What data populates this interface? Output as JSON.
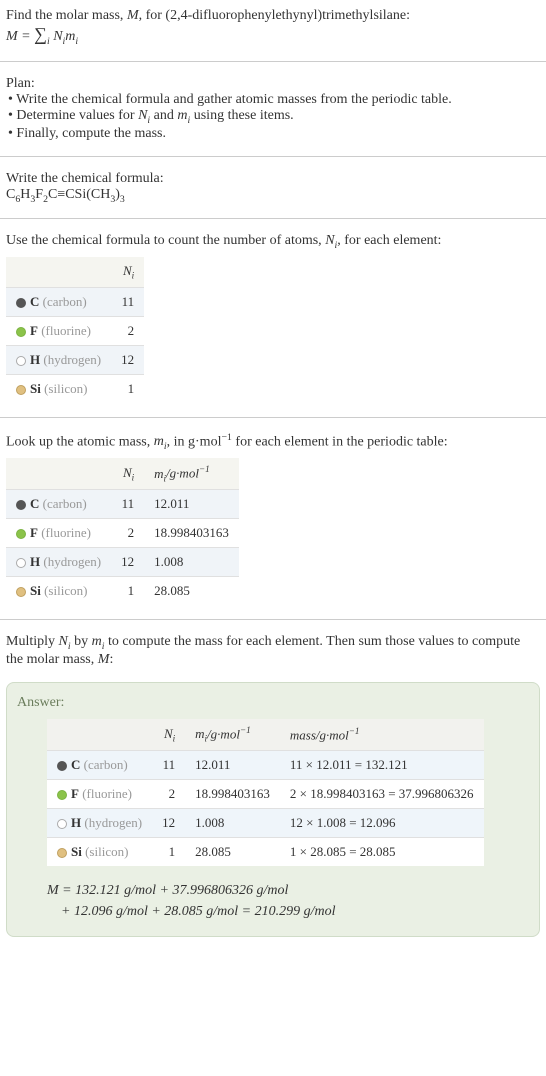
{
  "intro": {
    "line1_prefix": "Find the molar mass, ",
    "line1_var": "M",
    "line1_suffix": ", for (2,4-difluorophenylethynyl)trimethylsilane:",
    "eq_lhs": "M",
    "eq_rhs_html": "∑",
    "eq_sub": "i",
    "eq_tail": " N_i m_i"
  },
  "plan": {
    "title": "Plan:",
    "items": [
      "• Write the chemical formula and gather atomic masses from the periodic table.",
      "• Determine values for N_i and m_i using these items.",
      "• Finally, compute the mass."
    ]
  },
  "formula_section": {
    "heading": "Write the chemical formula:",
    "formula": "C6H3F2C≡CSi(CH3)3"
  },
  "count_section": {
    "heading_prefix": "Use the chemical formula to count the number of atoms, ",
    "heading_var": "N_i",
    "heading_suffix": ", for each element:",
    "header_ni": "N_i",
    "rows": [
      {
        "dot": "dot-c",
        "sym": "C",
        "name": "(carbon)",
        "ni": "11"
      },
      {
        "dot": "dot-f",
        "sym": "F",
        "name": "(fluorine)",
        "ni": "2"
      },
      {
        "dot": "dot-h",
        "sym": "H",
        "name": "(hydrogen)",
        "ni": "12"
      },
      {
        "dot": "dot-si",
        "sym": "Si",
        "name": "(silicon)",
        "ni": "1"
      }
    ]
  },
  "mass_section": {
    "heading": "Look up the atomic mass, m_i, in g·mol⁻¹ for each element in the periodic table:",
    "header_ni": "N_i",
    "header_mi": "m_i/g·mol⁻¹",
    "rows": [
      {
        "dot": "dot-c",
        "sym": "C",
        "name": "(carbon)",
        "ni": "11",
        "mi": "12.011"
      },
      {
        "dot": "dot-f",
        "sym": "F",
        "name": "(fluorine)",
        "ni": "2",
        "mi": "18.998403163"
      },
      {
        "dot": "dot-h",
        "sym": "H",
        "name": "(hydrogen)",
        "ni": "12",
        "mi": "1.008"
      },
      {
        "dot": "dot-si",
        "sym": "Si",
        "name": "(silicon)",
        "ni": "1",
        "mi": "28.085"
      }
    ]
  },
  "multiply_section": {
    "text": "Multiply N_i by m_i to compute the mass for each element. Then sum those values to compute the molar mass, M:"
  },
  "answer": {
    "label": "Answer:",
    "header_ni": "N_i",
    "header_mi": "m_i/g·mol⁻¹",
    "header_mass": "mass/g·mol⁻¹",
    "rows": [
      {
        "dot": "dot-c",
        "sym": "C",
        "name": "(carbon)",
        "ni": "11",
        "mi": "12.011",
        "mass": "11 × 12.011 = 132.121"
      },
      {
        "dot": "dot-f",
        "sym": "F",
        "name": "(fluorine)",
        "ni": "2",
        "mi": "18.998403163",
        "mass": "2 × 18.998403163 = 37.996806326"
      },
      {
        "dot": "dot-h",
        "sym": "H",
        "name": "(hydrogen)",
        "ni": "12",
        "mi": "1.008",
        "mass": "12 × 1.008 = 12.096"
      },
      {
        "dot": "dot-si",
        "sym": "Si",
        "name": "(silicon)",
        "ni": "1",
        "mi": "28.085",
        "mass": "1 × 28.085 = 28.085"
      }
    ],
    "final_line1": "M = 132.121 g/mol + 37.996806326 g/mol",
    "final_line2": "    + 12.096 g/mol + 28.085 g/mol = 210.299 g/mol"
  },
  "chart_data": {
    "type": "table",
    "title": "Molar mass computation for (2,4-difluorophenylethynyl)trimethylsilane",
    "elements": [
      {
        "element": "C",
        "name": "carbon",
        "N_i": 11,
        "m_i": 12.011,
        "mass": 132.121
      },
      {
        "element": "F",
        "name": "fluorine",
        "N_i": 2,
        "m_i": 18.998403163,
        "mass": 37.996806326
      },
      {
        "element": "H",
        "name": "hydrogen",
        "N_i": 12,
        "m_i": 1.008,
        "mass": 12.096
      },
      {
        "element": "Si",
        "name": "silicon",
        "N_i": 1,
        "m_i": 28.085,
        "mass": 28.085
      }
    ],
    "molar_mass_g_per_mol": 210.299
  }
}
